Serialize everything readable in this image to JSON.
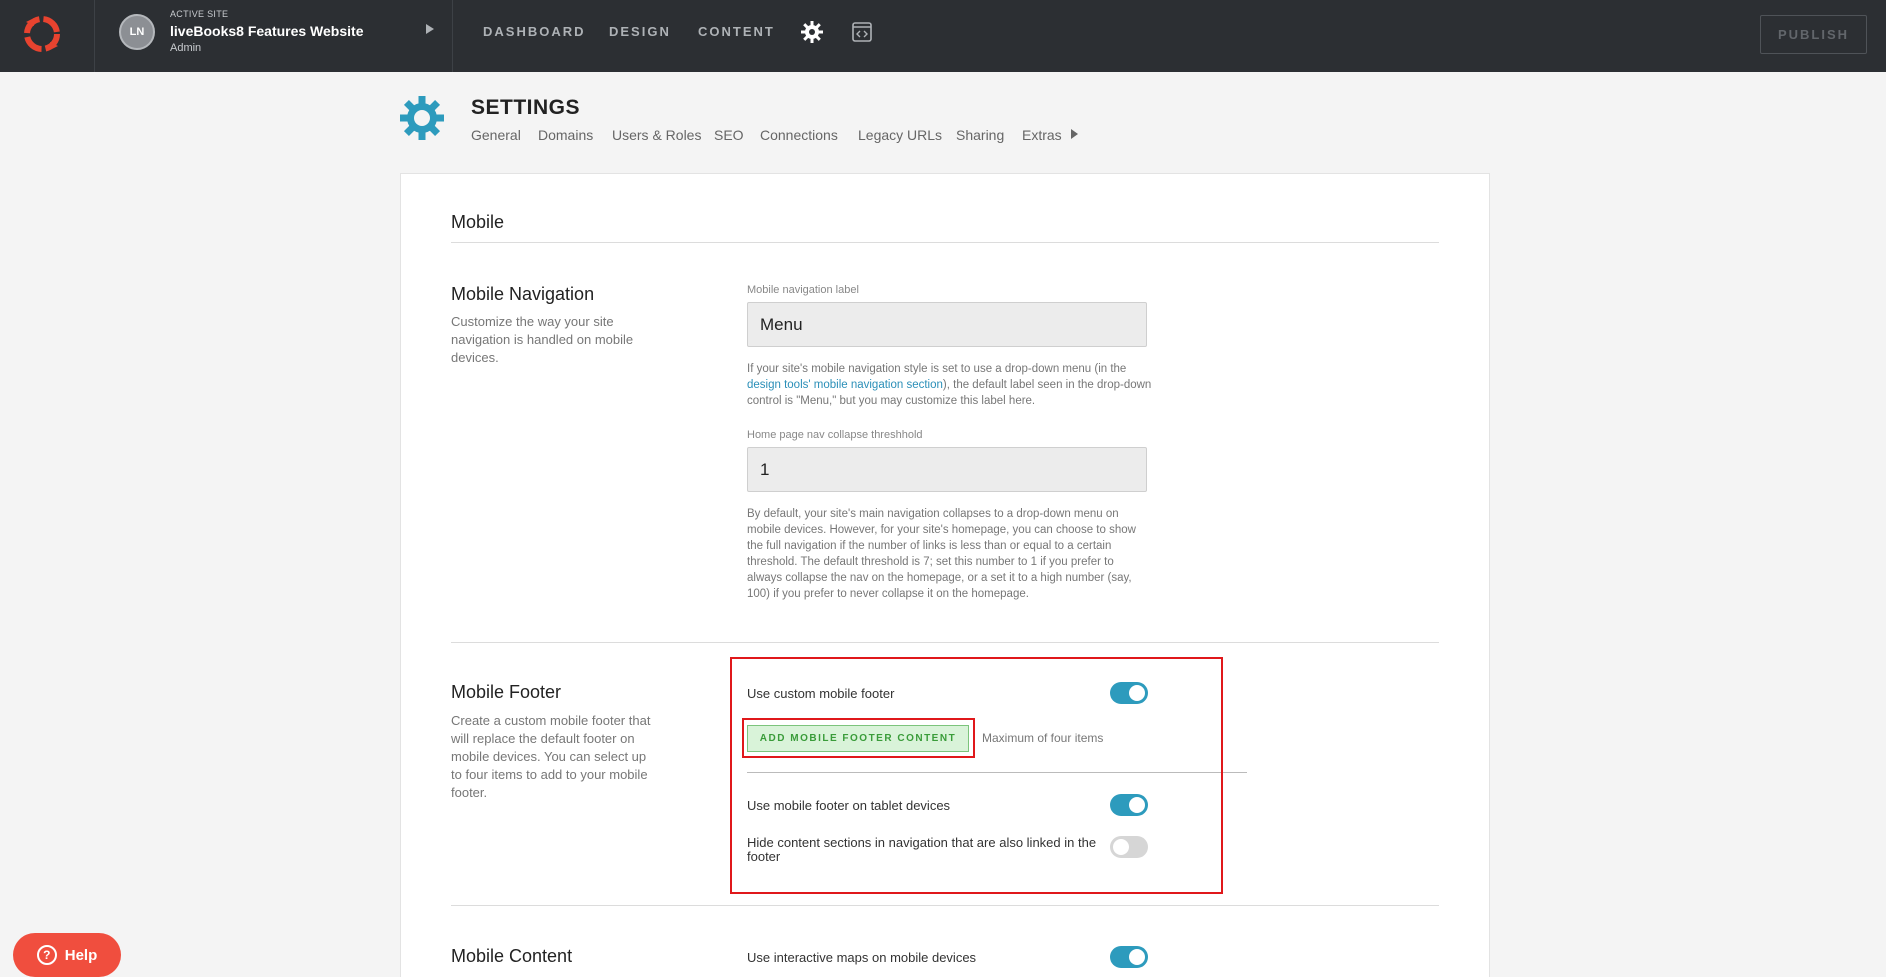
{
  "topbar": {
    "avatar_initials": "LN",
    "active_site_caption": "ACTIVE SITE",
    "site_name": "liveBooks8 Features Website",
    "site_role": "Admin",
    "nav": [
      "DASHBOARD",
      "DESIGN",
      "CONTENT"
    ],
    "publish_label": "PUBLISH",
    "brand_color": "#e8432f"
  },
  "settings": {
    "title": "SETTINGS",
    "tabs": [
      "General",
      "Domains",
      "Users & Roles",
      "SEO",
      "Connections",
      "Legacy URLs",
      "Sharing",
      "Extras"
    ]
  },
  "panel": {
    "heading": "Mobile",
    "navigation": {
      "title": "Mobile Navigation",
      "description": "Customize the way your site navigation is handled on mobile devices.",
      "label_field": {
        "label": "Mobile navigation label",
        "value": "Menu"
      },
      "label_help_before": "If your site's mobile navigation style is set to use a drop-down menu (in the ",
      "label_help_link": "design tools' mobile navigation section",
      "label_help_after": "), the default label seen in the drop-down control is \"Menu,\" but you may customize this label here.",
      "threshold_field": {
        "label": "Home page nav collapse threshhold",
        "value": "1"
      },
      "threshold_help": "By default, your site's main navigation collapses to a drop-down menu on mobile devices. However, for your site's homepage, you can choose to show the full navigation if the number of links is less than or equal to a certain threshold. The default threshold is 7; set this number to 1 if you prefer to always collapse the nav on the homepage, or a set it to a high number (say, 100) if you prefer to never collapse it on the homepage."
    },
    "footer": {
      "title": "Mobile Footer",
      "description": "Create a custom mobile footer that will replace the default footer on mobile devices. You can select up to four items to add to your mobile footer.",
      "use_custom_label": "Use custom mobile footer",
      "use_custom_on": true,
      "add_button": "ADD MOBILE FOOTER CONTENT",
      "max_items": "Maximum of four items",
      "tablet_label": "Use mobile footer on tablet devices",
      "tablet_on": true,
      "hide_label": "Hide content sections in navigation that are also linked in the footer",
      "hide_on": false
    },
    "content": {
      "title": "Mobile Content",
      "maps_label": "Use interactive maps on mobile devices",
      "maps_on": true
    }
  },
  "help_button": "Help",
  "accent_color": "#2d9bbd",
  "highlight_color": "#e0181b"
}
